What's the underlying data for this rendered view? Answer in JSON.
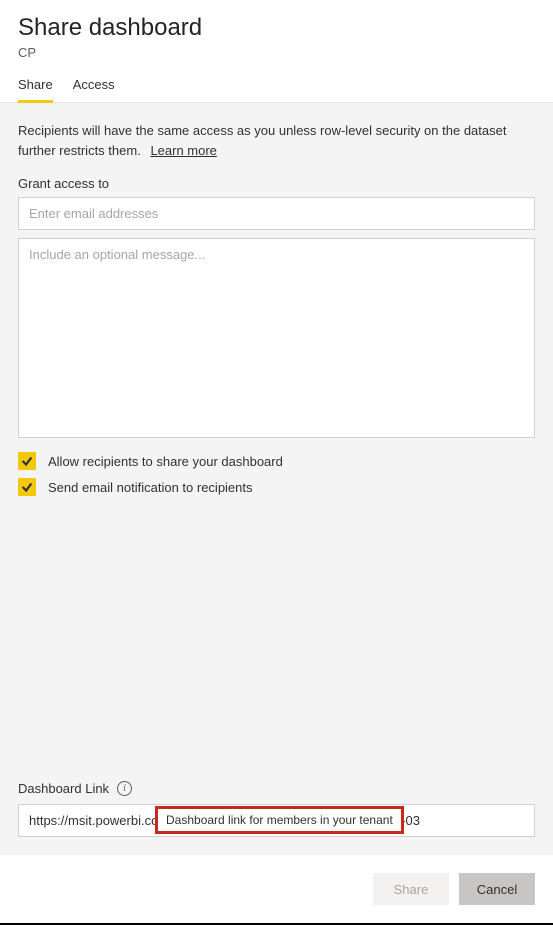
{
  "header": {
    "title": "Share dashboard",
    "subtitle": "CP"
  },
  "tabs": {
    "share": "Share",
    "access": "Access"
  },
  "panel": {
    "info_text": "Recipients will have the same access as you unless row-level security on the dataset further restricts them.",
    "learn_more": "Learn more",
    "grant_label": "Grant access to",
    "email_placeholder": "Enter email addresses",
    "message_placeholder": "Include an optional message...",
    "checkbox_allow": "Allow recipients to share your dashboard",
    "checkbox_email": "Send email notification to recipients",
    "link_label": "Dashboard Link",
    "info_icon_glyph": "i",
    "link_value": "https://msit.powerbi.com/dashboards/1234abce-b972-4020-81e3-03",
    "tooltip": "Dashboard link for members in your tenant"
  },
  "footer": {
    "share": "Share",
    "cancel": "Cancel"
  }
}
